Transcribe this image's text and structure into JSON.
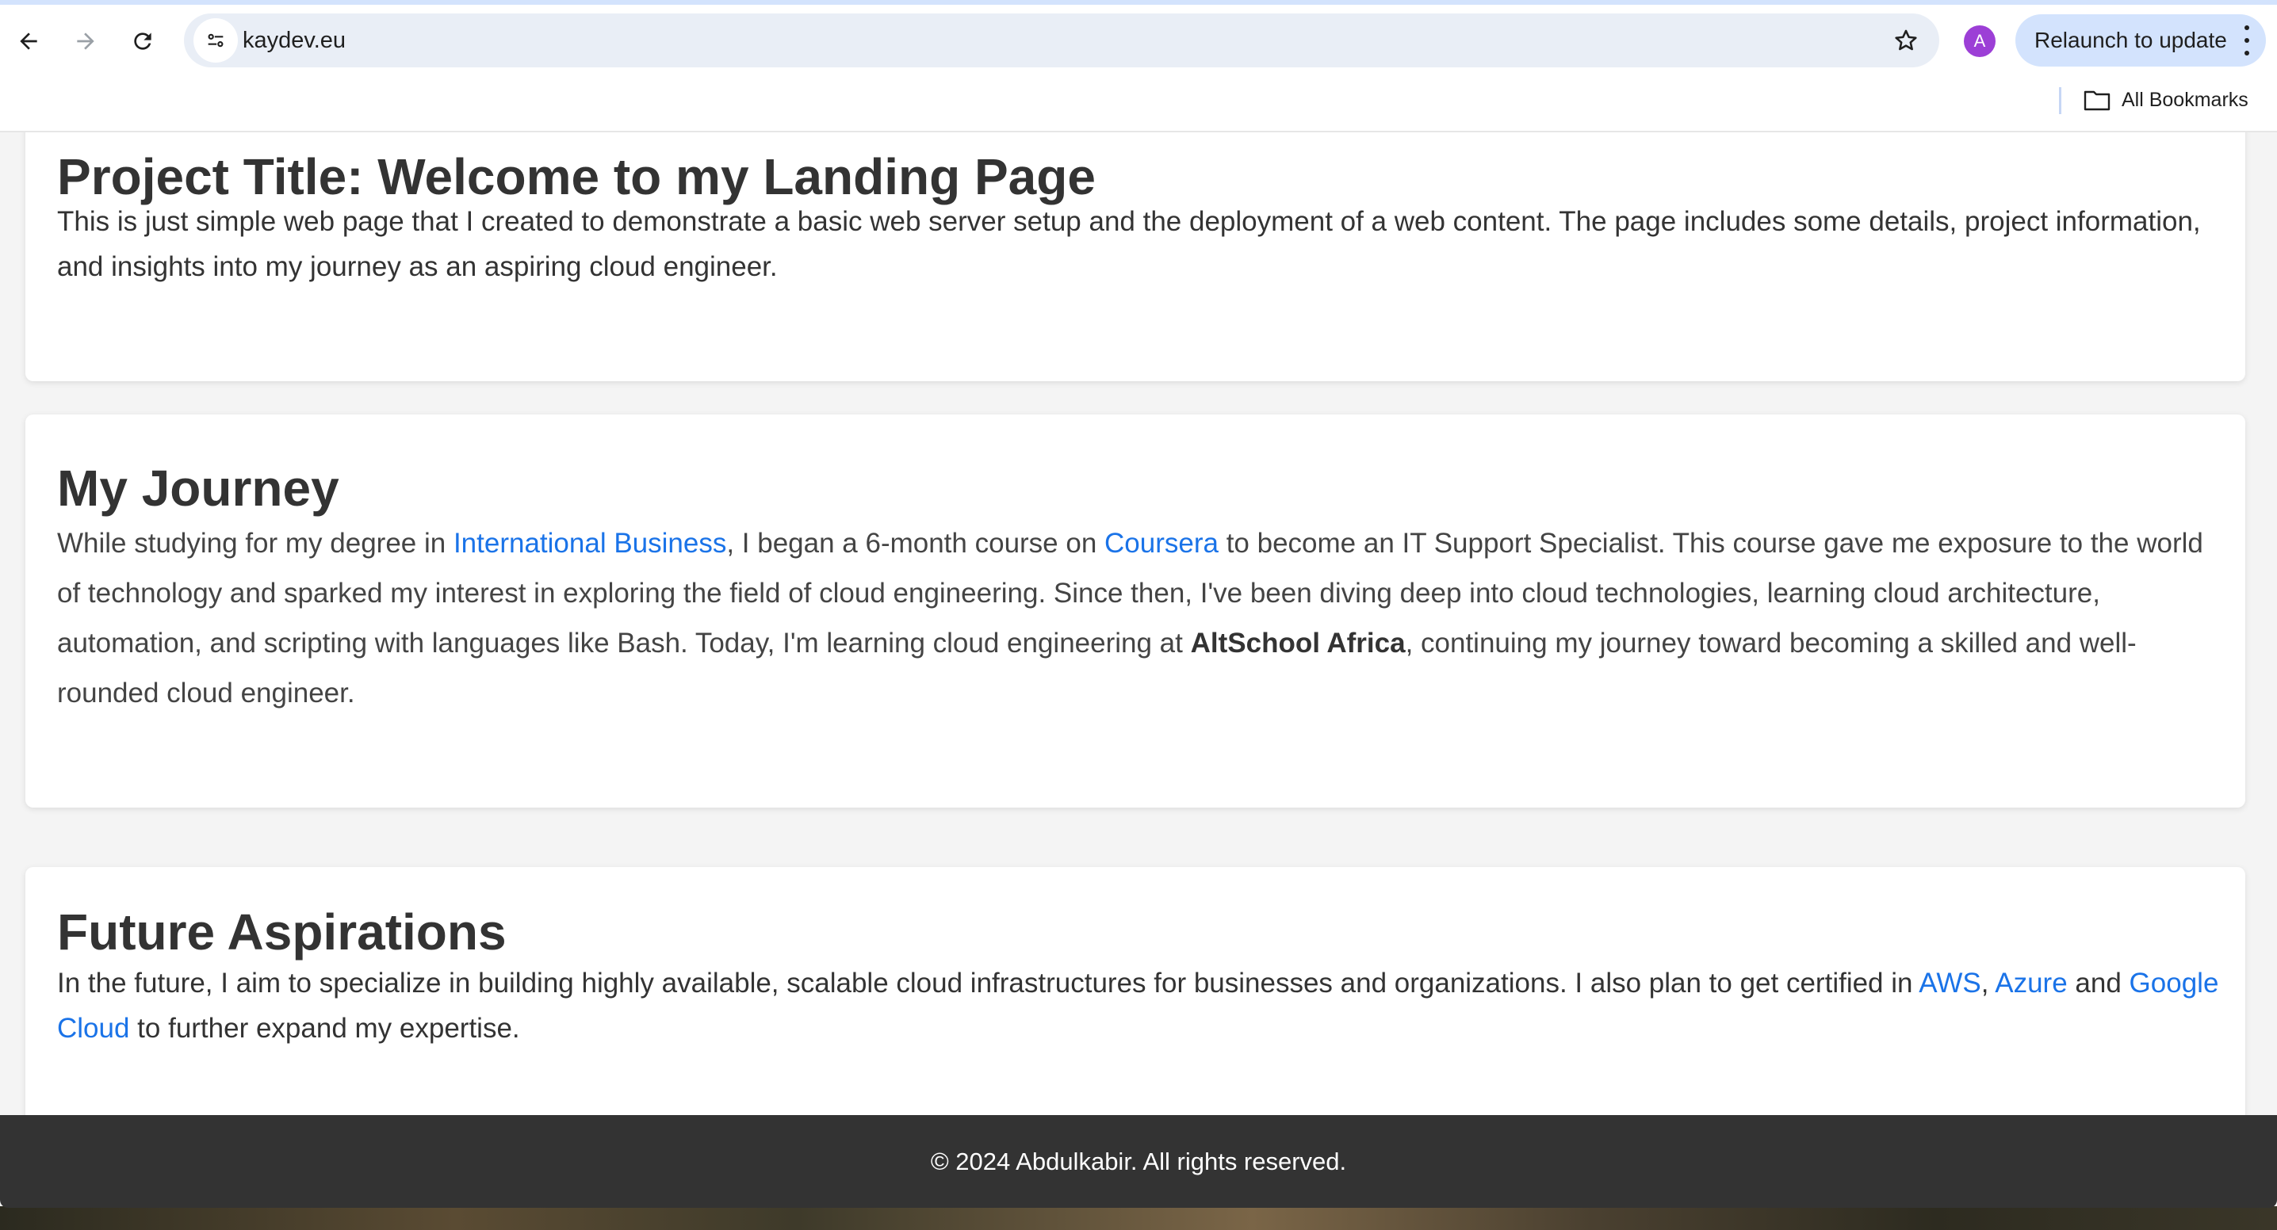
{
  "browser": {
    "url": "kaydev.eu",
    "profile_initial": "A",
    "relaunch_label": "Relaunch to update",
    "bookmarks_label": "All Bookmarks",
    "icons": [
      "back-arrow-icon",
      "forward-arrow-icon",
      "reload-icon",
      "site-settings-icon",
      "star-icon",
      "kebab-menu-icon",
      "folder-icon"
    ]
  },
  "page": {
    "project": {
      "title": "Project Title: Welcome to my Landing Page",
      "description": "This is just simple web page that I created to demonstrate a basic web server setup and the deployment of a web content. The page includes some details, project information, and insights into my journey as an aspiring cloud engineer."
    },
    "journey": {
      "title": "My Journey",
      "p1": "While studying for my degree in ",
      "link_business": "International Business",
      "p2": ", I began a 6-month course on ",
      "link_coursera": "Coursera",
      "p3": " to become an IT Support Specialist. This course gave me exposure to the world of technology and sparked my interest in exploring the field of cloud engineering. Since then, I've been diving deep into cloud technologies, learning cloud architecture, automation, and scripting with languages like Bash. Today, I'm learning cloud engineering at ",
      "bold_altschool": "AltSchool Africa",
      "p4": ", continuing my journey toward becoming a skilled and well-rounded cloud engineer."
    },
    "future": {
      "title": "Future Aspirations",
      "p1": "In the future, I aim to specialize in building highly available, scalable cloud infrastructures for businesses and organizations. I also plan to get certified in ",
      "link_aws": "AWS",
      "sep": ", ",
      "link_azure": "Azure",
      "and": " and ",
      "link_gcp": "Google Cloud",
      "p2": " to further expand my expertise."
    },
    "footer": "© 2024 Abdulkabir. All rights reserved."
  },
  "colors": {
    "link": "#1a73e8",
    "text": "#333333",
    "footer_bg": "#333333",
    "profile": "#9c3fd6",
    "relaunch_bg": "#d3e3fd"
  }
}
